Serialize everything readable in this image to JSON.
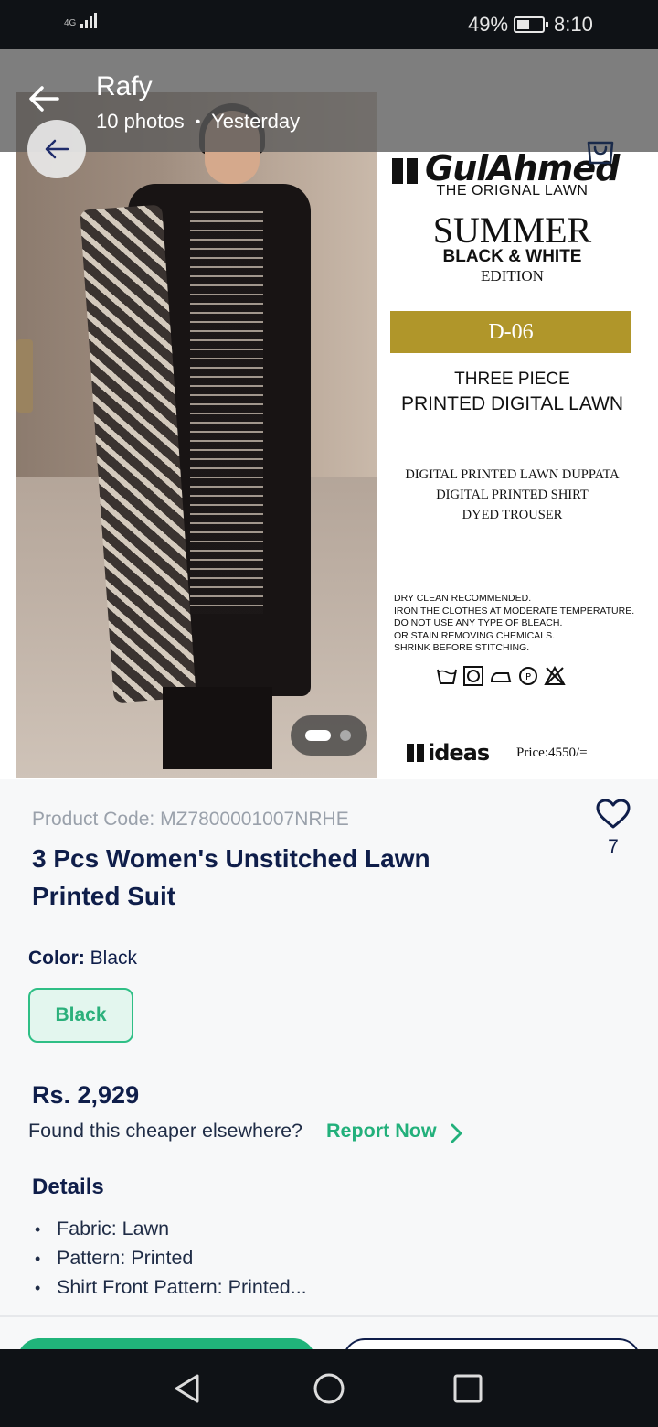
{
  "status_bar": {
    "network": "4G",
    "battery_percent": "49%",
    "battery_level": 0.49,
    "time": "8:10"
  },
  "gallery_header": {
    "sender": "Rafy",
    "photo_count": "10 photos",
    "separator": "•",
    "when": "Yesterday"
  },
  "product_image": {
    "brand_logo": "GulAhmed",
    "tagline": "THE ORIGNAL LAWN",
    "collection": "SUMMER",
    "subtitle": "BLACK & WHITE",
    "edition": "EDITION",
    "design_code": "D-06",
    "piece_count": "THREE PIECE",
    "fabric_line": "PRINTED DIGITAL LAWN",
    "contents": [
      "DIGITAL PRINTED LAWN DUPPATA",
      "DIGITAL PRINTED SHIRT",
      "DYED TROUSER"
    ],
    "care_instructions": [
      "DRY CLEAN RECOMMENDED.",
      "IRON THE CLOTHES AT MODERATE TEMPERATURE.",
      "DO NOT USE ANY TYPE OF BLEACH.",
      "OR STAIN REMOVING CHEMICALS.",
      "SHRINK BEFORE STITCHING."
    ],
    "store_logo": "ideas",
    "tag_price": "Price:4550/=",
    "carousel_position": 1,
    "carousel_total": 2
  },
  "product": {
    "code": "Product Code: MZ7800001007NRHE",
    "title": "3 Pcs Women's Unstitched Lawn Printed Suit",
    "wishlist_count": "7",
    "color_label": "Color:",
    "color_value": "Black",
    "color_options": [
      "Black"
    ],
    "price": "Rs. 2,929",
    "cheaper_prompt": "Found this cheaper elsewhere?",
    "report_link": "Report Now"
  },
  "details": {
    "title": "Details",
    "items": [
      "Fabric: Lawn",
      "Pattern: Printed",
      "Shirt Front Pattern: Printed..."
    ]
  },
  "colors": {
    "accent_green": "#22b07b",
    "navy_text": "#0f1e4a",
    "gold_banner": "#b0962a"
  },
  "icons": {
    "back": "arrow-left-icon",
    "wishlist": "heart-outline-icon",
    "cart": "shopping-bag-icon",
    "chevron": "chevron-right-icon",
    "nav_back": "triangle-back-icon",
    "nav_home": "circle-home-icon",
    "nav_recent": "square-recents-icon"
  }
}
